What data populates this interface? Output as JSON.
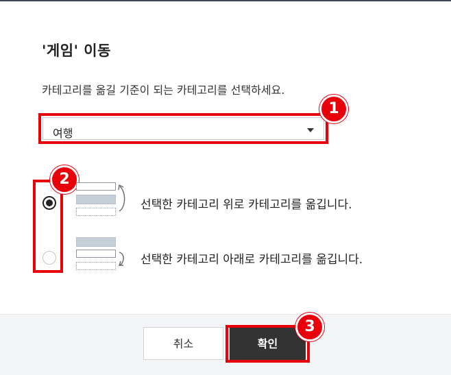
{
  "dialog": {
    "title": "'게임' 이동",
    "description": "카테고리를 옮길 기준이 되는 카테고리를 선택하세요.",
    "select": {
      "value": "여행"
    },
    "options": [
      {
        "label": "선택한 카테고리 위로 카테고리를 옮깁니다.",
        "checked": true
      },
      {
        "label": "선택한 카테고리 아래로 카테고리를 옮깁니다.",
        "checked": false
      }
    ],
    "buttons": {
      "cancel": "취소",
      "confirm": "확인"
    }
  },
  "annotations": [
    "1",
    "2",
    "3"
  ],
  "colors": {
    "highlight": "#e8000b",
    "confirm_bg": "#333333",
    "footer_bg": "#f4f5f7"
  }
}
